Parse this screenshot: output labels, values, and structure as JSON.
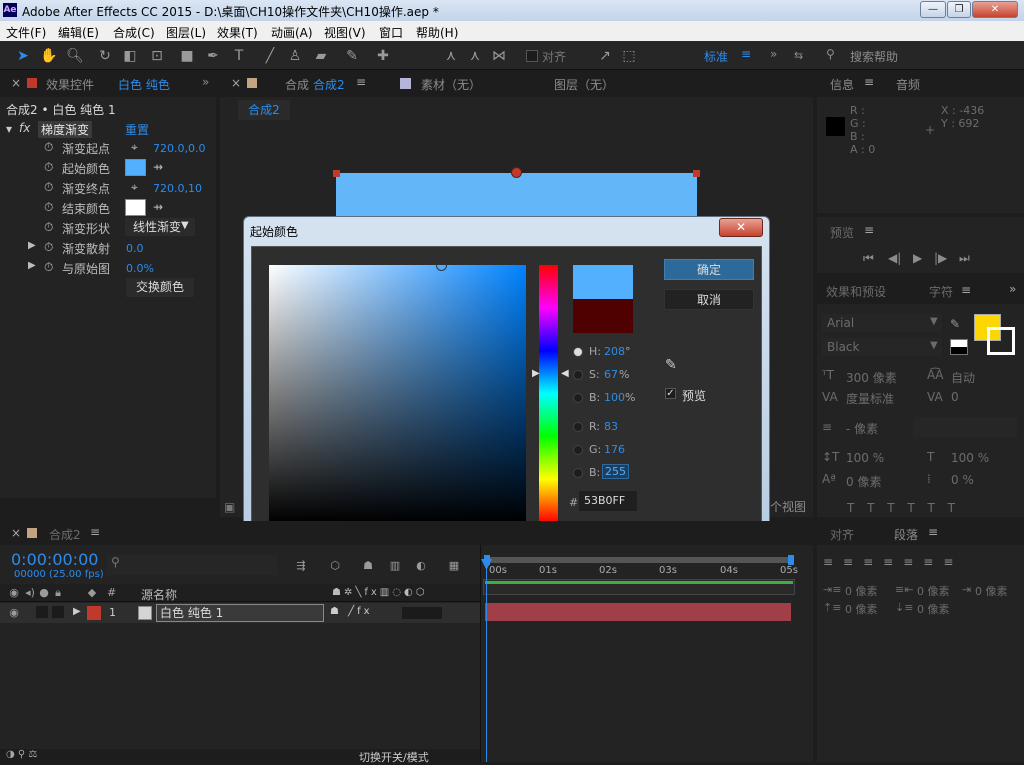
{
  "window": {
    "title": "Adobe After Effects CC 2015 - D:\\桌面\\CH10操作文件夹\\CH10操作.aep *",
    "logo": "Ae",
    "min": "—",
    "max": "❐",
    "close": "✕"
  },
  "menu": [
    "文件(F)",
    "编辑(E)",
    "合成(C)",
    "图层(L)",
    "效果(T)",
    "动画(A)",
    "视图(V)",
    "窗口",
    "帮助(H)"
  ],
  "toolbar": {
    "align_label": "对齐",
    "workspace": "标准",
    "search_placeholder": "搜索帮助"
  },
  "effects_panel": {
    "tab": "效果控件",
    "tab_layer": "白色 纯色",
    "breadcrumb": "合成2 • 白色 纯色 1",
    "fx_name": "梯度渐变",
    "reset": "重置",
    "props": [
      {
        "name": "渐变起点",
        "value": "720.0,0.0"
      },
      {
        "name": "起始颜色",
        "value": ""
      },
      {
        "name": "渐变终点",
        "value": "720.0,10"
      },
      {
        "name": "结束颜色",
        "value": ""
      },
      {
        "name": "渐变形状",
        "value": "线性渐变"
      },
      {
        "name": "渐变散射",
        "value": "0.0"
      },
      {
        "name": "与原始图",
        "value": "0.0%"
      }
    ],
    "swap_button": "交换颜色"
  },
  "comp_panel": {
    "tab_prefix": "合成",
    "tab_name": "合成2",
    "footage_tab": "素材（无）",
    "layer_tab": "图层（无）",
    "comp_label": "合成2",
    "view_label": "个视图"
  },
  "info_panel": {
    "tab": "信息",
    "audio_tab": "音频",
    "r": "R :",
    "g": "G :",
    "b": "B :",
    "a": "A : 0",
    "x": "X : -436",
    "y": "Y : 692"
  },
  "preview_panel": {
    "tab": "预览"
  },
  "effects_presets": {
    "tab": "效果和预设",
    "char_tab": "字符"
  },
  "character": {
    "font": "Arial",
    "style": "Black",
    "size": "300 像素",
    "leading": "自动",
    "kerning": "度量标准",
    "tracking": "0",
    "stroke": "- 像素",
    "vscale": "100 %",
    "hscale": "100 %",
    "baseline": "0 像素",
    "tsume": "0 %",
    "fill_color": "#ffd700"
  },
  "paragraph": {
    "align_tab": "对齐",
    "para_tab": "段落",
    "indent1": "0 像素",
    "indent2": "0 像素",
    "indent3": "0 像素",
    "space1": "0 像素",
    "space2": "0 像素"
  },
  "timeline": {
    "tab": "合成2",
    "timecode": "0:00:00:00",
    "frames": "00000 (25.00 fps)",
    "col_source": "源名称",
    "layer_num": "1",
    "layer_name": "白色 纯色 1",
    "ticks": [
      "00s",
      "01s",
      "02s",
      "03s",
      "04s",
      "05s"
    ],
    "footer": "切换开关/模式"
  },
  "color_dialog": {
    "title": "起始颜色",
    "ok": "确定",
    "cancel": "取消",
    "preview_label": "预览",
    "h_label": "H:",
    "h": "208",
    "h_unit": "°",
    "s_label": "S:",
    "s": "67",
    "s_unit": "%",
    "bv_label": "B:",
    "bv": "100",
    "bv_unit": "%",
    "r_label": "R:",
    "r": "83",
    "g_label": "G:",
    "g": "176",
    "b_label": "B:",
    "b": "255",
    "hex_label": "#",
    "hex": "53B0FF",
    "new_color": "#53b0ff",
    "old_color": "#4f0000"
  }
}
